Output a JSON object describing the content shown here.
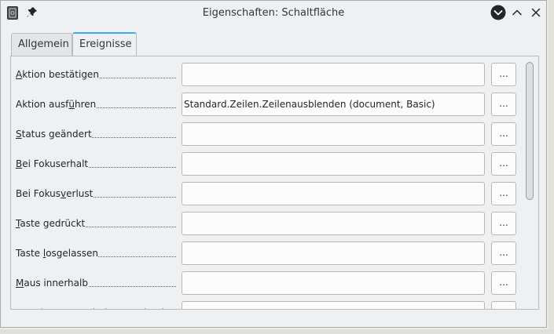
{
  "window": {
    "title": "Eigenschaften: Schaltfläche",
    "app_icon": "document-icon",
    "pin_icon": "pin-icon",
    "buttons": [
      "more-options-icon",
      "maximize-icon",
      "close-icon"
    ]
  },
  "tabs": [
    {
      "label": "Allgemein",
      "active": false
    },
    {
      "label": "Ereignisse",
      "active": true
    }
  ],
  "events": [
    {
      "pre": "",
      "u": "A",
      "post": "ktion bestätigen",
      "value": "",
      "button": "..."
    },
    {
      "pre": "Aktion ausf",
      "u": "ü",
      "post": "hren",
      "value": "Standard.Zeilen.Zeilenausblenden (document, Basic)",
      "button": "..."
    },
    {
      "pre": "",
      "u": "S",
      "post": "tatus geändert",
      "value": "",
      "button": "..."
    },
    {
      "pre": "",
      "u": "B",
      "post": "ei Fokuserhalt",
      "value": "",
      "button": "..."
    },
    {
      "pre": "Bei Fokus",
      "u": "v",
      "post": "erlust",
      "value": "",
      "button": "..."
    },
    {
      "pre": "",
      "u": "T",
      "post": "aste gedrückt",
      "value": "",
      "button": "..."
    },
    {
      "pre": "Taste ",
      "u": "l",
      "post": "osgelassen",
      "value": "",
      "button": "..."
    },
    {
      "pre": "",
      "u": "M",
      "post": "aus innerhalb",
      "value": "",
      "button": "..."
    },
    {
      "pre": "Mausbewegung bei Tastendruck",
      "u": "",
      "post": "",
      "value": "",
      "button": "..."
    }
  ],
  "colors": {
    "accent": "#3daee9",
    "window_bg": "#eff0f1",
    "text": "#232629"
  }
}
